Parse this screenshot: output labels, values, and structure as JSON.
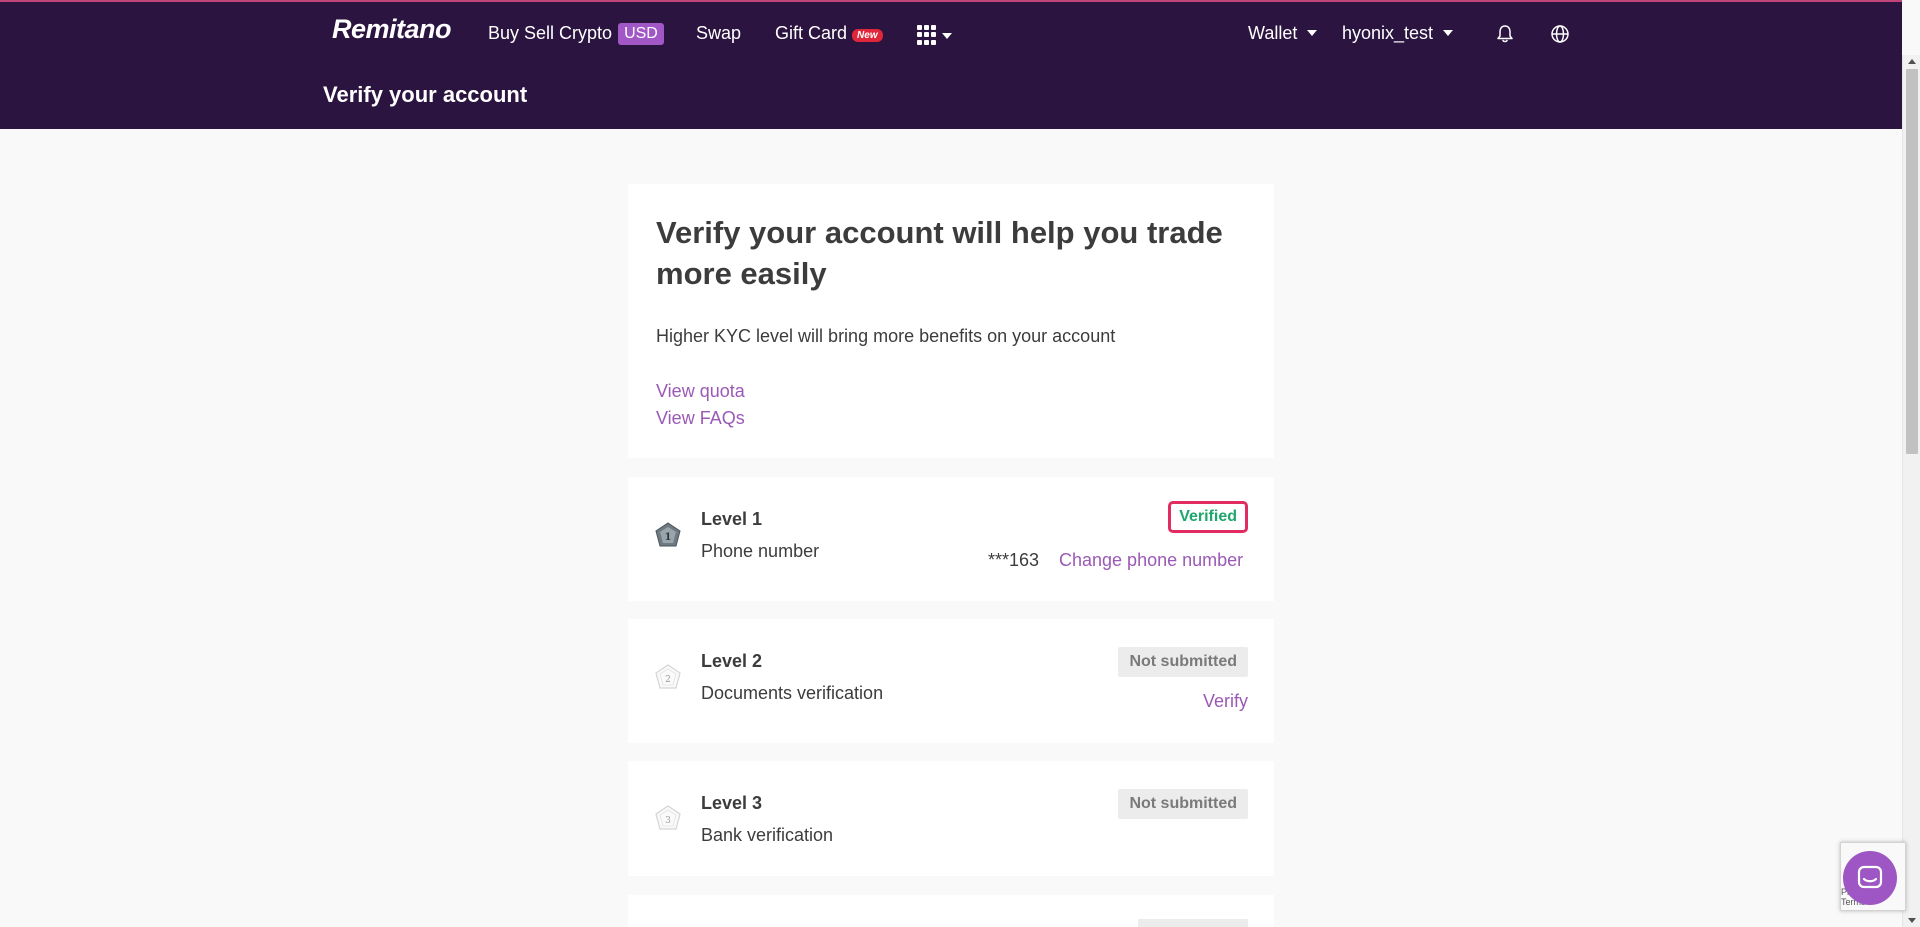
{
  "nav": {
    "logo": "Remitano",
    "buy_sell": "Buy Sell Crypto",
    "currency_badge": "USD",
    "swap": "Swap",
    "gift_card": "Gift Card",
    "new_badge": "New",
    "wallet": "Wallet",
    "username": "hyonix_test",
    "icons": [
      "apps-grid-icon",
      "bell-icon",
      "globe-icon"
    ]
  },
  "header": {
    "title": "Verify your account"
  },
  "intro": {
    "title": "Verify your account will help you trade more easily",
    "description": "Higher KYC level will bring more benefits on your account",
    "link_quota": "View quota",
    "link_faqs": "View FAQs"
  },
  "levels": [
    {
      "number": "1",
      "name": "Level 1",
      "description": "Phone number",
      "status": "Verified",
      "masked_phone": "***163",
      "action": "Change phone number"
    },
    {
      "number": "2",
      "name": "Level 2",
      "description": "Documents verification",
      "status": "Not submitted",
      "action": "Verify"
    },
    {
      "number": "3",
      "name": "Level 3",
      "description": "Bank verification",
      "status": "Not submitted"
    }
  ],
  "widget": {
    "recaptcha_text": "Privacy - Terms"
  },
  "colors": {
    "nav_bg": "#2b1440",
    "accent": "#9b59b6",
    "verified": "#1fa66a",
    "highlight_border": "#e22b61"
  }
}
